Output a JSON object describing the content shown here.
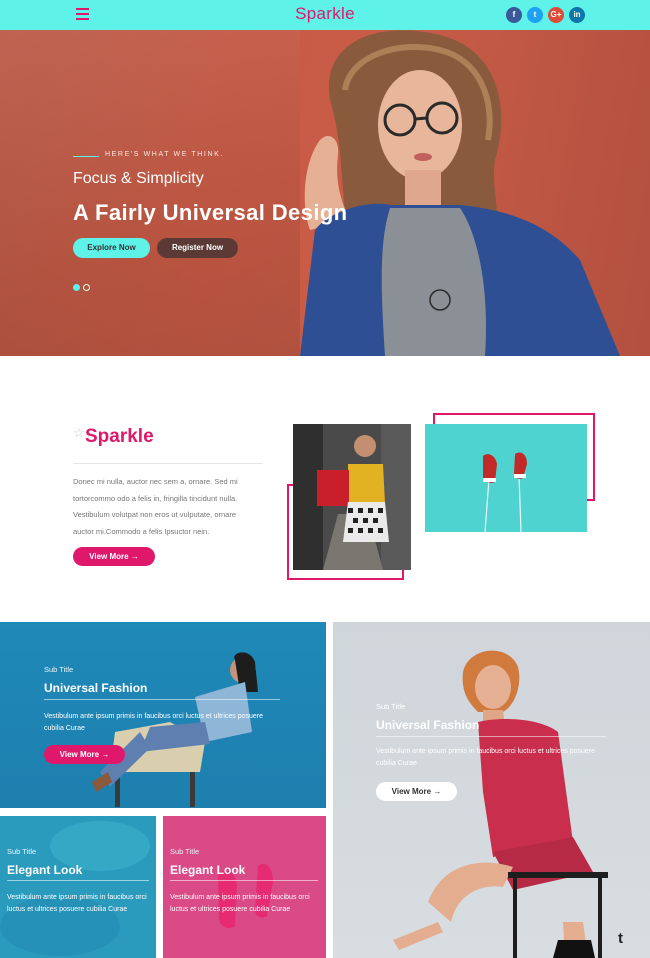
{
  "nav": {
    "brand": "Sparkle",
    "social": [
      {
        "icon": "facebook-icon",
        "glyph": "f"
      },
      {
        "icon": "twitter-icon",
        "glyph": "t"
      },
      {
        "icon": "google-plus-icon",
        "glyph": "G+"
      },
      {
        "icon": "linkedin-icon",
        "glyph": "in"
      }
    ]
  },
  "hero": {
    "eyebrow": "HERE'S WHAT WE THINK.",
    "subtitle": "Focus & Simplicity",
    "title": "A Fairly Universal Design",
    "explore_label": "Explore Now",
    "register_label": "Register Now",
    "active_slide": 1,
    "slide_count": 2
  },
  "about": {
    "title": "Sparkle",
    "text": "Donec mi nulla, auctor nec sem a, ornare. Sed mi tortorcommo odo a felis in, fringilla tincidunt nulla. Vestibulum volutpat non eros ut vulputate, ornare auctor mi.Commodo a felis Ipsuctor nein.",
    "button_label": "View More →"
  },
  "features": [
    {
      "subtitle": "Sub Title",
      "title": "Universal Fashion",
      "text": "Vestibulum ante ipsum primis in faucibus orci luctus et ultrices posuere cubilia Curae",
      "button_label": "View More →"
    },
    {
      "subtitle": "Sub Title",
      "title": "Universal Fashion",
      "text": "Vestibulum ante ipsum primis in faucibus orci luctus et ultrices posuere cubilia Curae",
      "button_label": "View More →"
    },
    {
      "subtitle": "Sub Title",
      "title": "Elegant Look",
      "text": "Vestibulum ante ipsum primis in faucibus orci luctus et ultrices posuere cubilia Curae"
    },
    {
      "subtitle": "Sub Title",
      "title": "Elegant Look",
      "text": "Vestibulum ante ipsum primis in faucibus orci luctus et ultrices posuere cubilia Curae"
    }
  ],
  "colors": {
    "accent": "#e0186c",
    "nav_bg": "#5ff2e8",
    "hero_bg": "#c75a45"
  },
  "corner_mark": "t"
}
